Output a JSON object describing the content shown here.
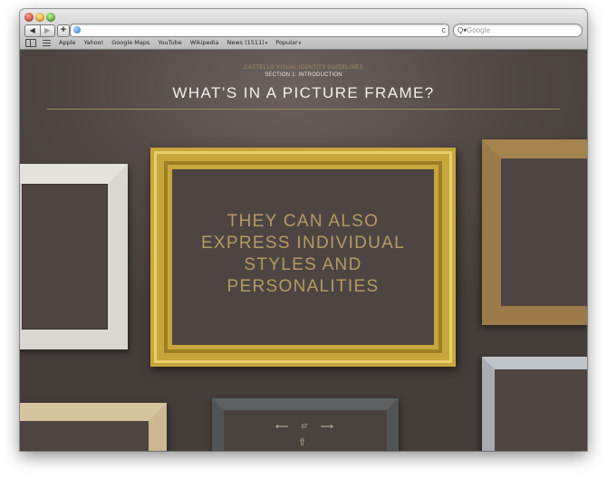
{
  "browser": {
    "window_controls": [
      "close",
      "minimize",
      "zoom"
    ],
    "nav": {
      "back_icon": "◀",
      "forward_icon": "▶",
      "add_icon": "+"
    },
    "address_bar": {
      "value": "",
      "reload_icon": "c"
    },
    "search": {
      "placeholder": "Google",
      "icon": "Q▾"
    },
    "bookmarks": [
      {
        "label": "Apple"
      },
      {
        "label": "Yahoo!"
      },
      {
        "label": "Google Maps"
      },
      {
        "label": "YouTube"
      },
      {
        "label": "Wikipedia"
      },
      {
        "label": "News (1511)",
        "dropdown": true
      },
      {
        "label": "Popular",
        "dropdown": true
      }
    ]
  },
  "page": {
    "supertitle": "CASTELLO VISUAL IDENTITY GUIDELINES",
    "section": "SECTION 1: INTRODUCTION",
    "title": "WHAT’S IN A PICTURE FRAME?",
    "headline": "THEY CAN ALSO\nEXPRESS INDIVIDUAL\nSTYLES AND\nPERSONALITIES",
    "pager": {
      "prev_icon": "⟵",
      "page_number": "07",
      "next_icon": "⟶",
      "home_icon": "⇧"
    },
    "colors": {
      "background": "#4e4542",
      "gold_text": "#b59a62",
      "title_text": "#f3efea",
      "rule": "#a08a62"
    },
    "frames": [
      "white",
      "gold",
      "wood",
      "silver",
      "stone",
      "beige"
    ]
  }
}
